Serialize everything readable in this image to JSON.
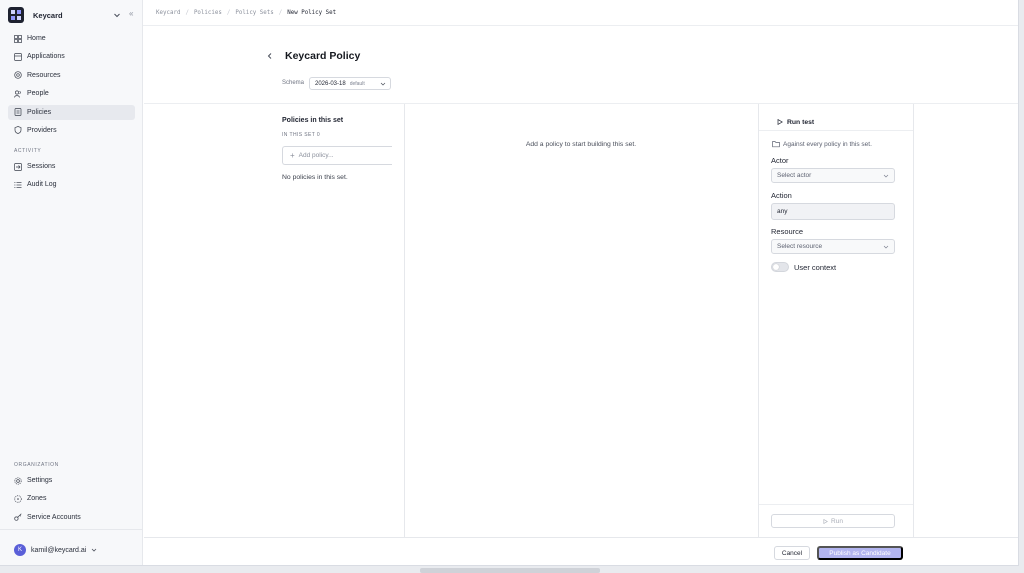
{
  "app": {
    "name": "Keycard",
    "brand_chevron_icon": "chevron-down-icon",
    "collapse_label": "«"
  },
  "sidebar": {
    "main_items": [
      {
        "label": "Home",
        "icon": "home-grid-icon"
      },
      {
        "label": "Applications",
        "icon": "applications-icon"
      },
      {
        "label": "Resources",
        "icon": "resources-icon"
      },
      {
        "label": "People",
        "icon": "people-icon"
      },
      {
        "label": "Policies",
        "icon": "policies-icon",
        "active": true
      },
      {
        "label": "Providers",
        "icon": "shield-icon"
      }
    ],
    "activity_label": "ACTIVITY",
    "activity_items": [
      {
        "label": "Sessions",
        "icon": "sessions-icon"
      },
      {
        "label": "Audit Log",
        "icon": "list-icon"
      }
    ],
    "organization_label": "ORGANIZATION",
    "organization_items": [
      {
        "label": "Settings",
        "icon": "gear-icon"
      },
      {
        "label": "Zones",
        "icon": "zones-icon"
      },
      {
        "label": "Service Accounts",
        "icon": "key-icon"
      }
    ],
    "user": {
      "initial": "K",
      "email": "kamil@keycard.ai"
    }
  },
  "breadcrumb": [
    "Keycard",
    "Policies",
    "Policy Sets",
    "New Policy Set"
  ],
  "breadcrumb_sep": "/",
  "page": {
    "title": "Keycard Policy",
    "schema_label": "Schema",
    "schema_value": "2026-03-18",
    "schema_tag": "default"
  },
  "policies_panel": {
    "title": "Policies in this set",
    "count_label": "IN THIS SET 0",
    "add_placeholder": "Add policy...",
    "empty_text": "No policies in this set."
  },
  "center": {
    "empty_text": "Add a policy to start building this set."
  },
  "test_panel": {
    "tab_label": "Run test",
    "scope_text": "Against every policy in this set.",
    "actor_label": "Actor",
    "actor_placeholder": "Select actor",
    "action_label": "Action",
    "action_value": "any",
    "resource_label": "Resource",
    "resource_placeholder": "Select resource",
    "user_context_label": "User context",
    "user_context_enabled": false,
    "run_label": "Run"
  },
  "footer": {
    "cancel_label": "Cancel",
    "publish_label": "Publish as Candidate"
  },
  "colors": {
    "accent": "#4b4fd6",
    "publish_disabled": "#b2b4ef",
    "avatar": "#5a5fd8"
  }
}
